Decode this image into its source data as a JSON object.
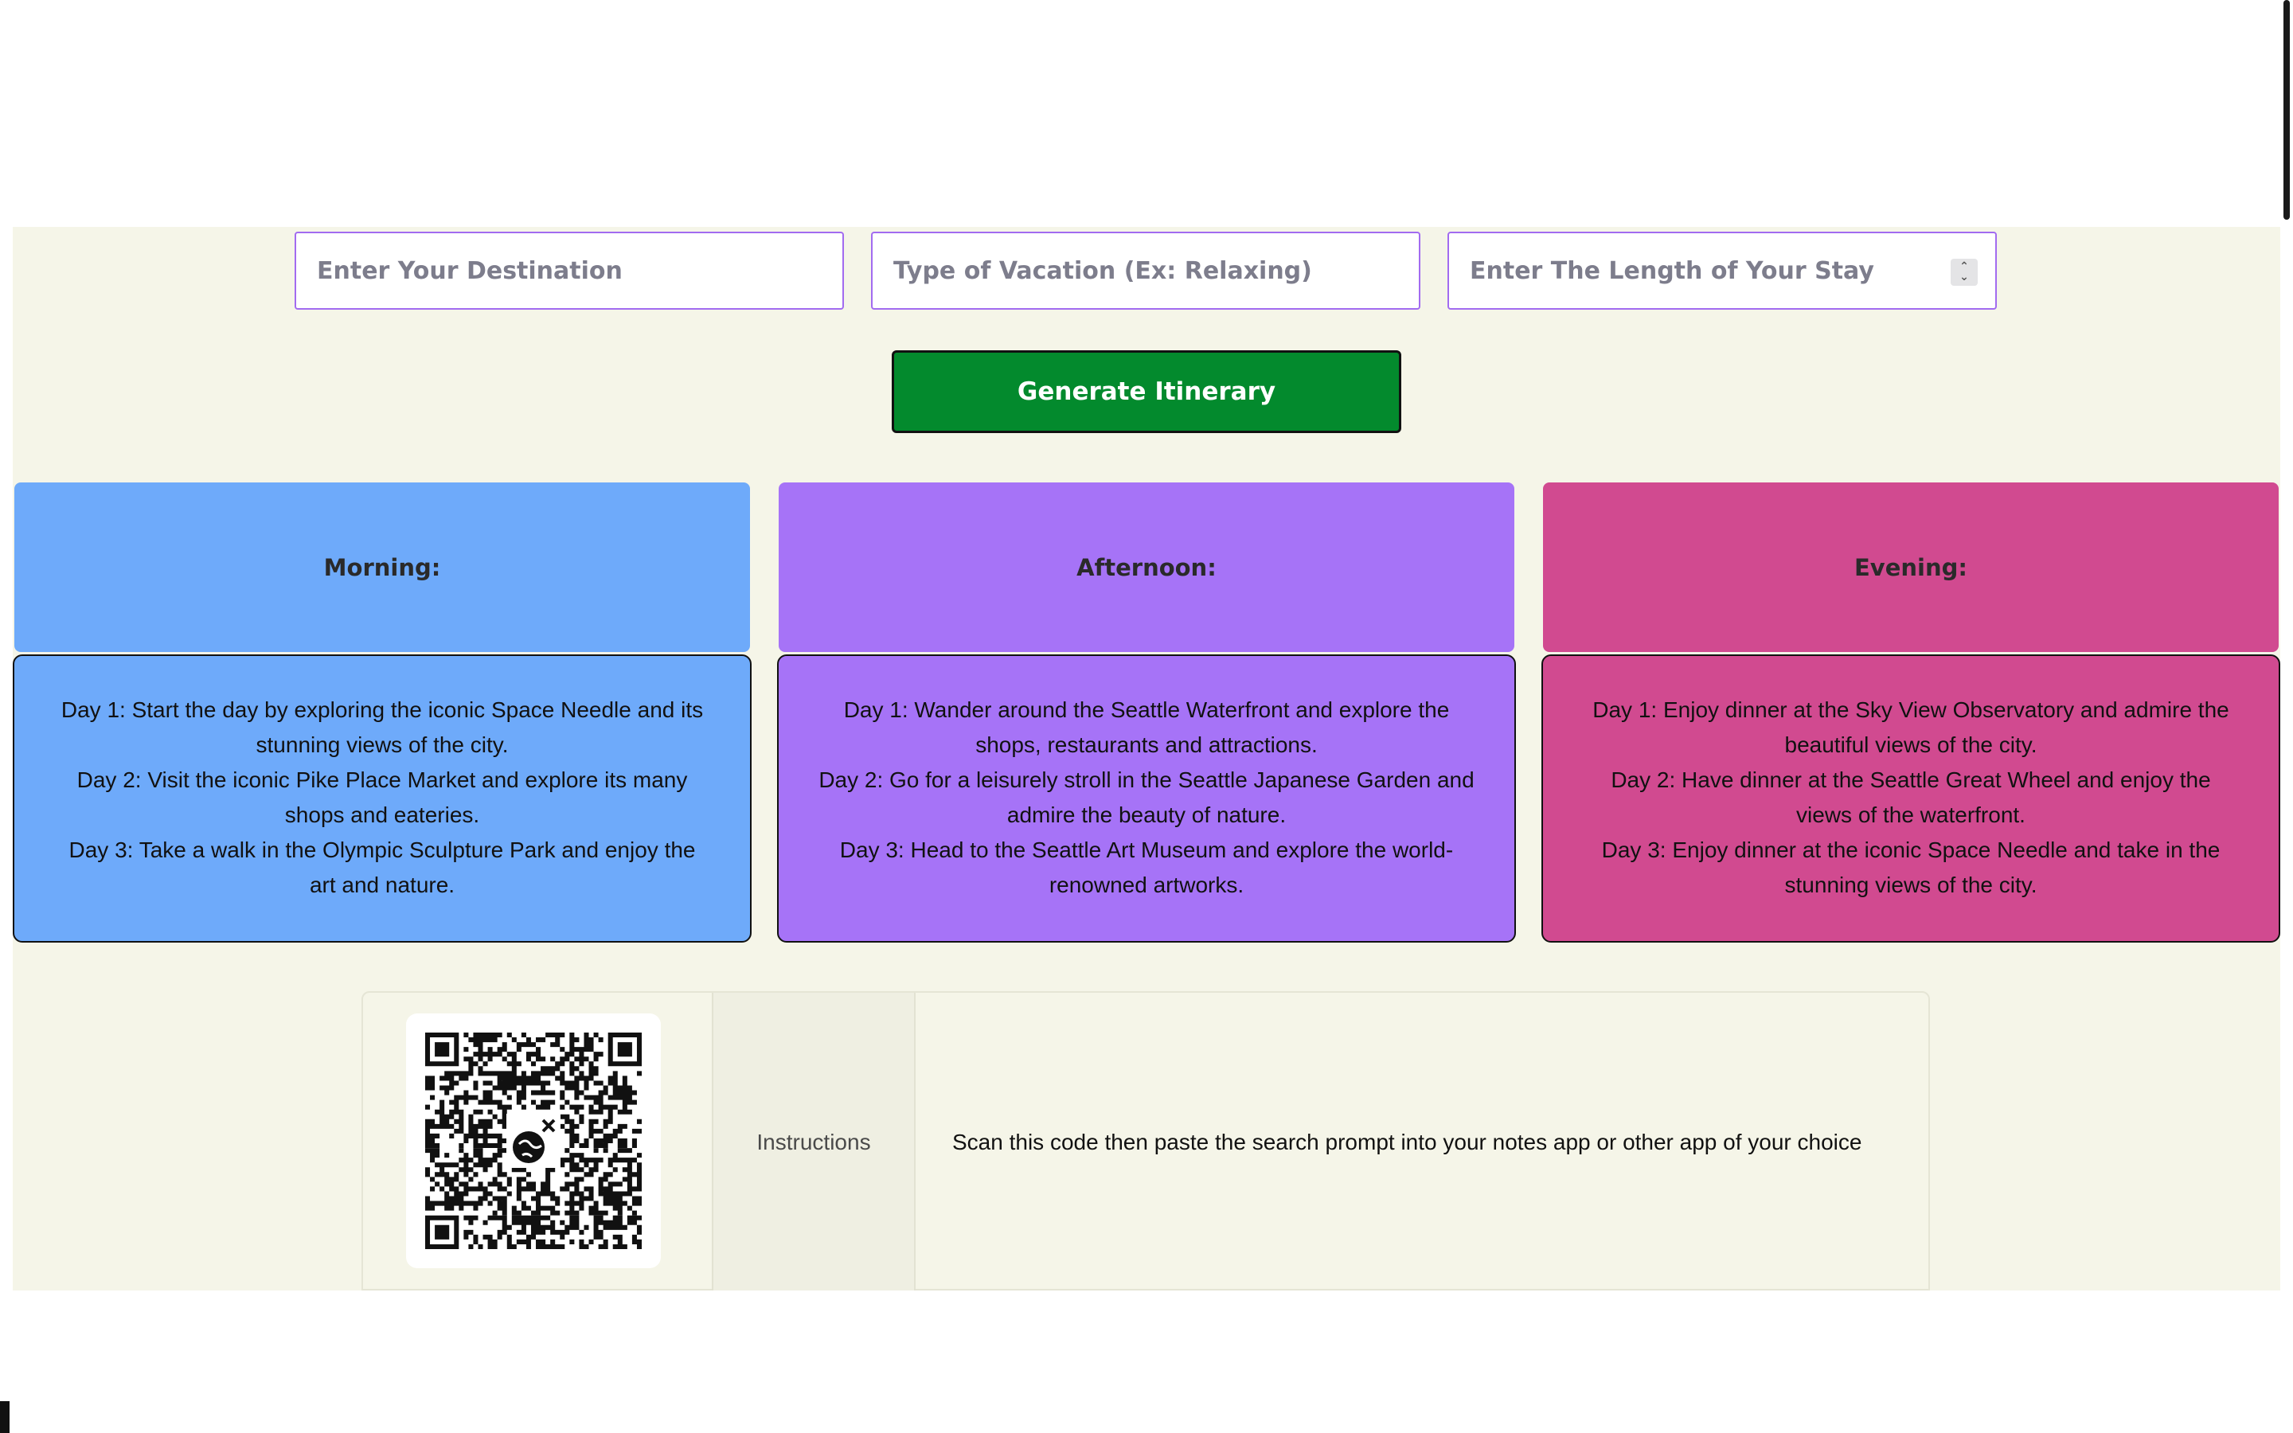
{
  "form": {
    "destination_placeholder": "Enter Your Destination",
    "vacation_type_placeholder": "Type of Vacation (Ex: Relaxing)",
    "stay_length_placeholder": "Enter The Length of Your Stay",
    "generate_label": "Generate Itinerary"
  },
  "itinerary": [
    {
      "title": "Morning:",
      "color": "#6eaafa",
      "days": [
        "Day 1: Start the day by exploring the iconic Space Needle and its stunning views of the city.",
        "Day 2: Visit the iconic Pike Place Market and explore its many shops and eateries.",
        "Day 3: Take a walk in the Olympic Sculpture Park and enjoy the art and nature."
      ]
    },
    {
      "title": "Afternoon:",
      "color": "#a673f7",
      "days": [
        "Day 1: Wander around the Seattle Waterfront and explore the shops, restaurants and attractions.",
        "Day 2: Go for a leisurely stroll in the Seattle Japanese Garden and admire the beauty of nature.",
        "Day 3: Head to the Seattle Art Museum and explore the world-renowned artworks."
      ]
    },
    {
      "title": "Evening:",
      "color": "#d14a90",
      "days": [
        "Day 1: Enjoy dinner at the Sky View Observatory and admire the beautiful views of the city.",
        "Day 2: Have dinner at the Seattle Great Wheel and enjoy the views of the waterfront.",
        "Day 3: Enjoy dinner at the iconic Space Needle and take in the stunning views of the city."
      ]
    }
  ],
  "qr_section": {
    "instructions_label": "Instructions",
    "instructions_text": "Scan this code then paste the search prompt into your notes app or other app of your choice",
    "qr_icon": "qr-code-icon",
    "center_icon": "globe-plane-icon"
  },
  "colors": {
    "button": "#038a2d",
    "input_border": "#a26bf0",
    "app_background": "#f5f5e8"
  }
}
